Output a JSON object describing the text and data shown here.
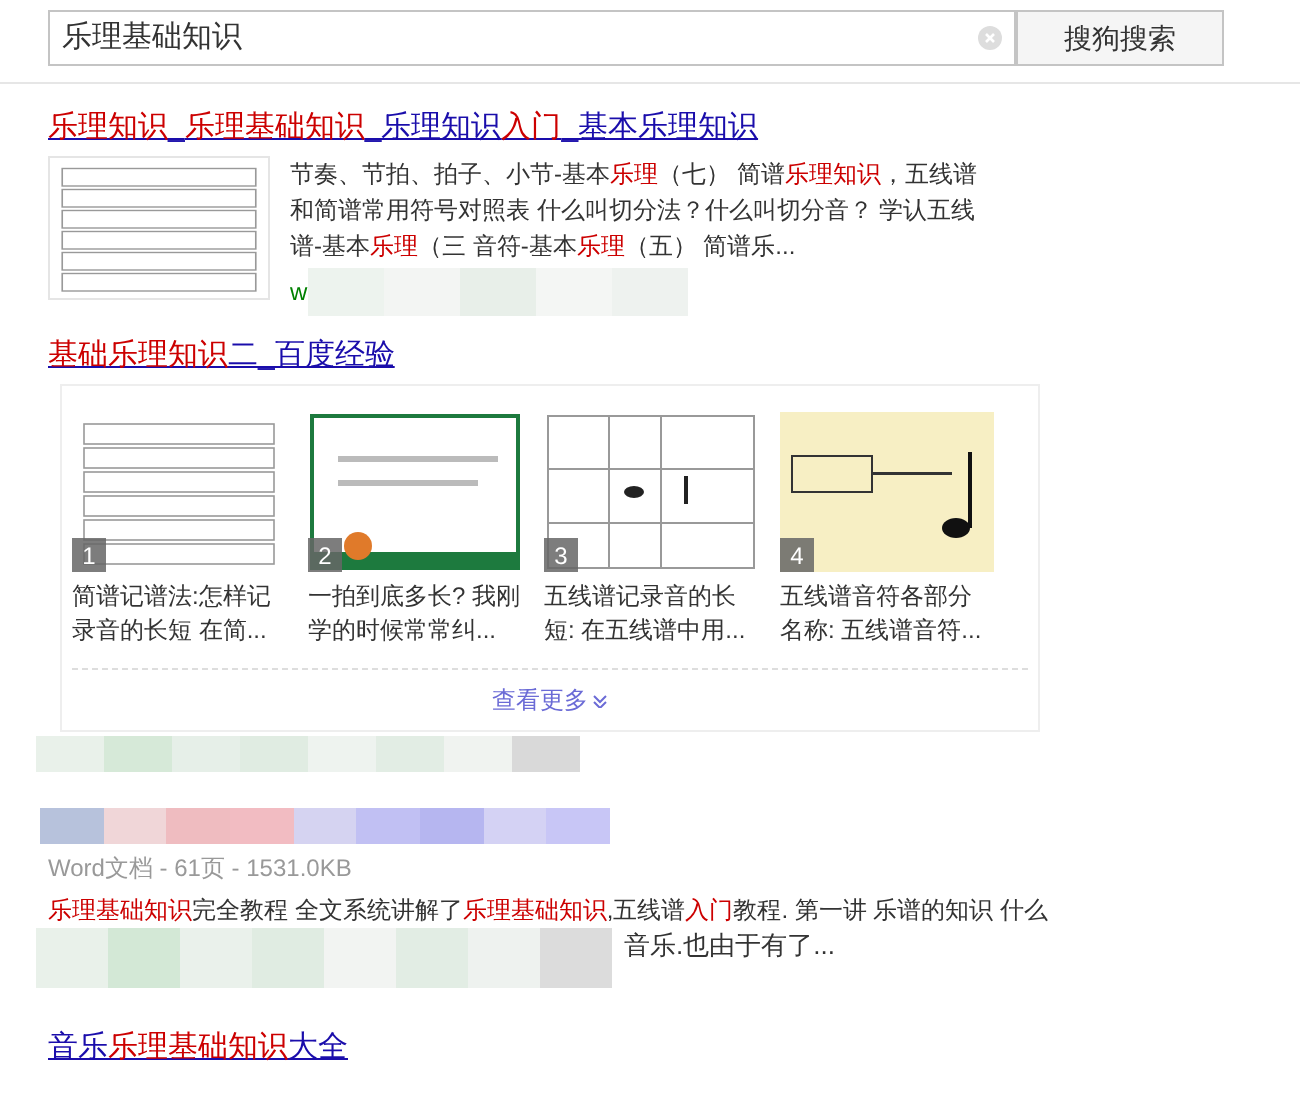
{
  "search": {
    "value": "乐理基础知识",
    "button": "搜狗搜索"
  },
  "results": [
    {
      "kind": "thumb",
      "title": [
        {
          "t": "乐理知识",
          "hl": true
        },
        {
          "t": "_",
          "hl": false
        },
        {
          "t": "乐理基础知识",
          "hl": true
        },
        {
          "t": "_乐理知识",
          "hl": false
        },
        {
          "t": "入门",
          "hl": true
        },
        {
          "t": "_基本乐理知识",
          "hl": false
        }
      ],
      "snippet": [
        {
          "t": "节奏、节拍、拍子、小节-基本",
          "hl": false
        },
        {
          "t": "乐理",
          "hl": true
        },
        {
          "t": "（七） 简谱",
          "hl": false
        },
        {
          "t": "乐理知识",
          "hl": true
        },
        {
          "t": "，五线谱和简谱常用符号对照表 什么叫切分法？什么叫切分音？ 学认五线谱-基本",
          "hl": false
        },
        {
          "t": "乐理",
          "hl": true
        },
        {
          "t": "（三 音符-基本",
          "hl": false
        },
        {
          "t": "乐理",
          "hl": true
        },
        {
          "t": "（五） 简谱乐...",
          "hl": false
        }
      ],
      "url": "w"
    },
    {
      "kind": "gallery",
      "title": [
        {
          "t": "基础乐理知识",
          "hl": true
        },
        {
          "t": "二_百度经验",
          "hl": false
        }
      ],
      "items": [
        {
          "badge": "1",
          "caption": "简谱记谱法:怎样记录音的长短 在简..."
        },
        {
          "badge": "2",
          "caption": "一拍到底多长? 我刚学的时候常常纠..."
        },
        {
          "badge": "3",
          "caption": "五线谱记录音的长短: 在五线谱中用..."
        },
        {
          "badge": "4",
          "caption": "五线谱音符各部分名称: 五线谱音符..."
        }
      ],
      "more": "查看更多"
    },
    {
      "kind": "doc",
      "meta": "Word文档 - 61页 - 1531.0KB",
      "snippet": [
        {
          "t": "乐理基础知识",
          "hl": true
        },
        {
          "t": "完全教程 全文系统讲解了",
          "hl": false
        },
        {
          "t": "乐理基础知识",
          "hl": true
        },
        {
          "t": ",五线谱",
          "hl": false
        },
        {
          "t": "入门",
          "hl": true
        },
        {
          "t": "教程. 第一讲 乐谱的知识 什么",
          "hl": false
        }
      ],
      "snippet_tail": "音乐.也由于有了..."
    },
    {
      "kind": "plain",
      "title": [
        {
          "t": "音乐",
          "hl": false
        },
        {
          "t": "乐理基础知识",
          "hl": true
        },
        {
          "t": "大全",
          "hl": false
        }
      ]
    }
  ]
}
